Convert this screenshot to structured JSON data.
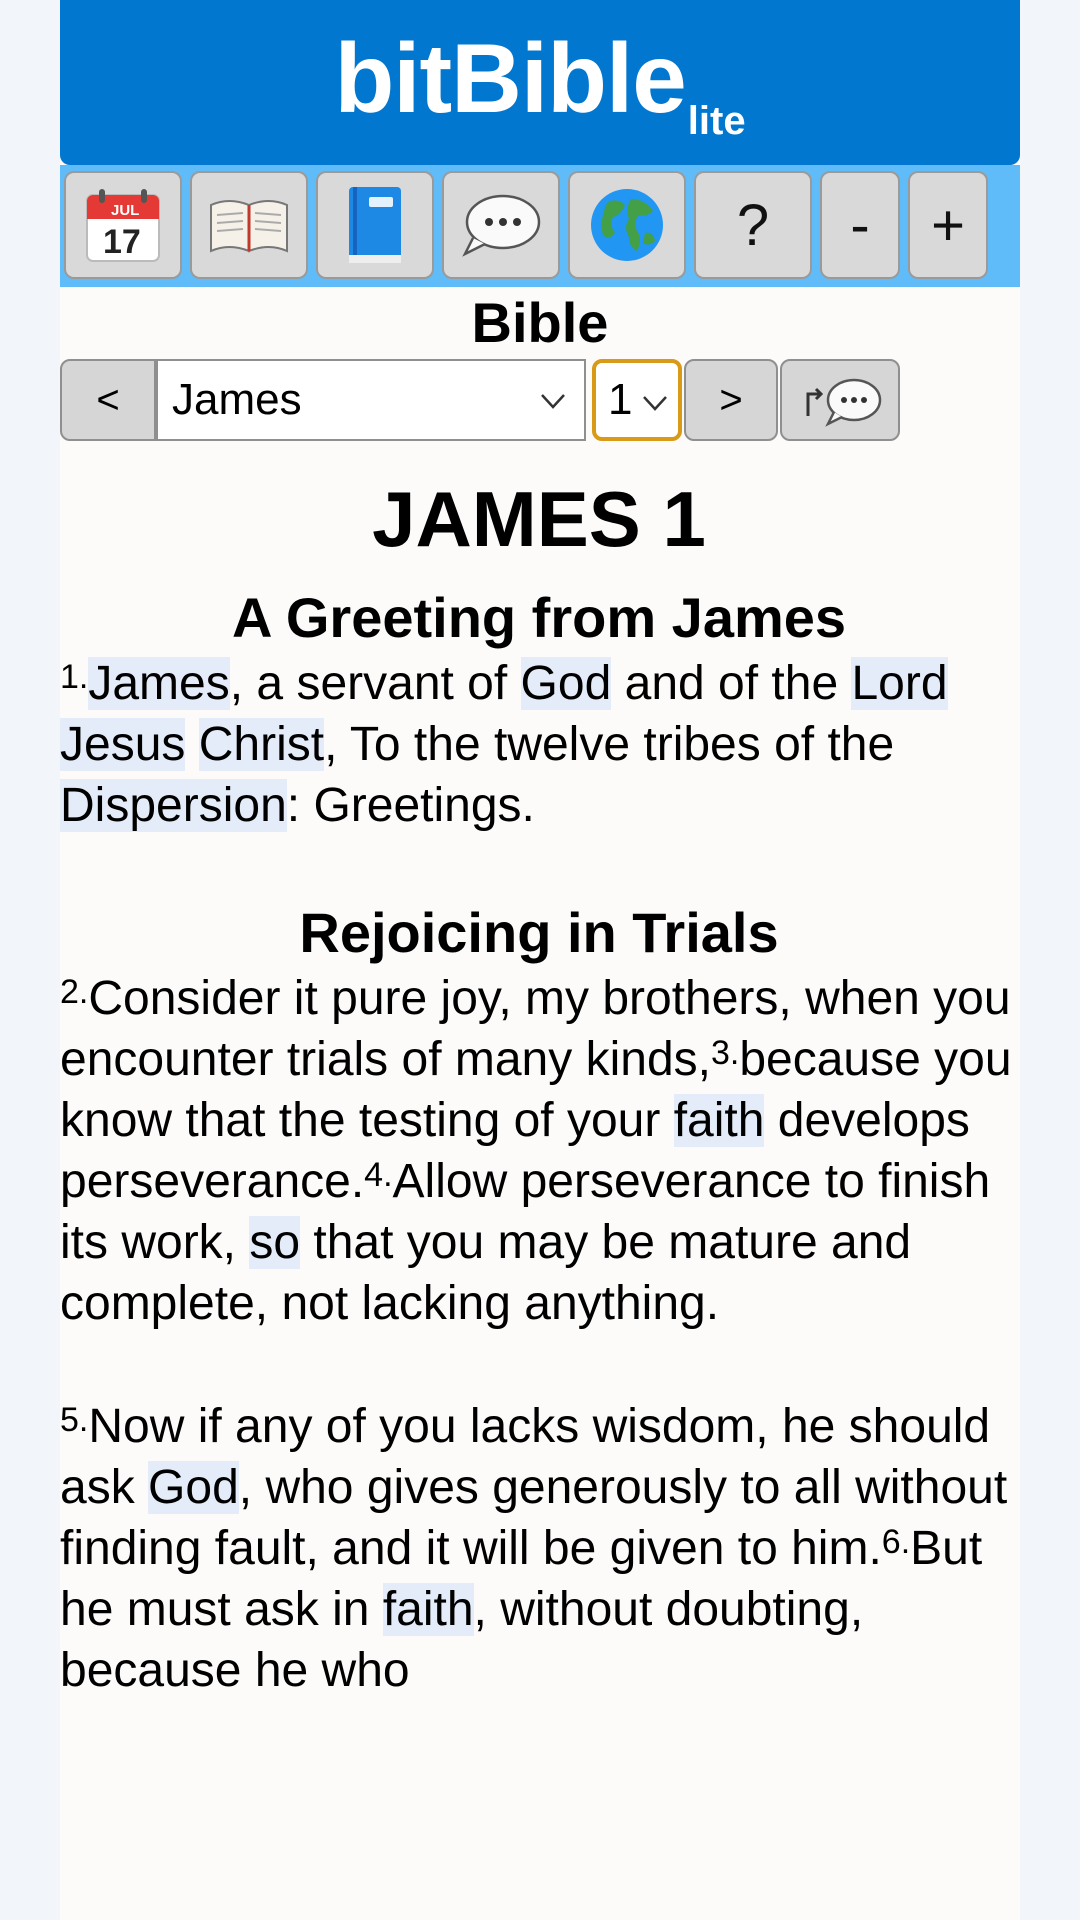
{
  "app": {
    "brand": "bitBible",
    "edition": "lite"
  },
  "toolbar": {
    "buttons": [
      {
        "icon": "calendar-icon",
        "month": "JUL",
        "day": "17"
      },
      {
        "icon": "open-book-icon"
      },
      {
        "icon": "blue-book-icon"
      },
      {
        "icon": "speech-bubble-icon"
      },
      {
        "icon": "globe-icon"
      },
      {
        "label": "?"
      },
      {
        "label": "-"
      },
      {
        "label": "+"
      }
    ]
  },
  "section_title": "Bible",
  "nav": {
    "prev_label": "<",
    "next_label": ">",
    "book": "James",
    "chapter": "1"
  },
  "reading": {
    "chapter_heading": "JAMES 1",
    "sections": [
      {
        "heading": "A Greeting from James",
        "verses": {
          "v1_num": "1.",
          "v1_a": "James",
          "v1_b": ", a servant of ",
          "v1_c": "God",
          "v1_d": " and of the ",
          "v1_e": "Lord",
          "v1_f": " ",
          "v1_g": "Jesus",
          "v1_h": " ",
          "v1_i": "Christ",
          "v1_j": ", To the twelve tribes of the ",
          "v1_k": "Dispersion",
          "v1_l": ": Greetings."
        }
      },
      {
        "heading": "Rejoicing in Trials",
        "verses": {
          "v2_num": "2.",
          "v2": "Consider it pure joy, my brothers, when you encounter trials of many kinds,",
          "v3_num": "3.",
          "v3_a": "because you know that the testing of your ",
          "v3_b": "faith",
          "v3_c": " develops perseverance.",
          "v4_num": "4.",
          "v4_a": "Allow perseverance to finish its work, ",
          "v4_b": "so",
          "v4_c": " that you may be mature and complete, not lacking anything.",
          "v5_num": "5.",
          "v5_a": "Now if any of you lacks wisdom, he should ask ",
          "v5_b": "God",
          "v5_c": ", who gives generously to all without finding fault, and it will be given to him.",
          "v6_num": "6.",
          "v6_a": "But he must ask in ",
          "v6_b": "faith",
          "v6_c": ", without doubting, because he who"
        }
      }
    ]
  }
}
